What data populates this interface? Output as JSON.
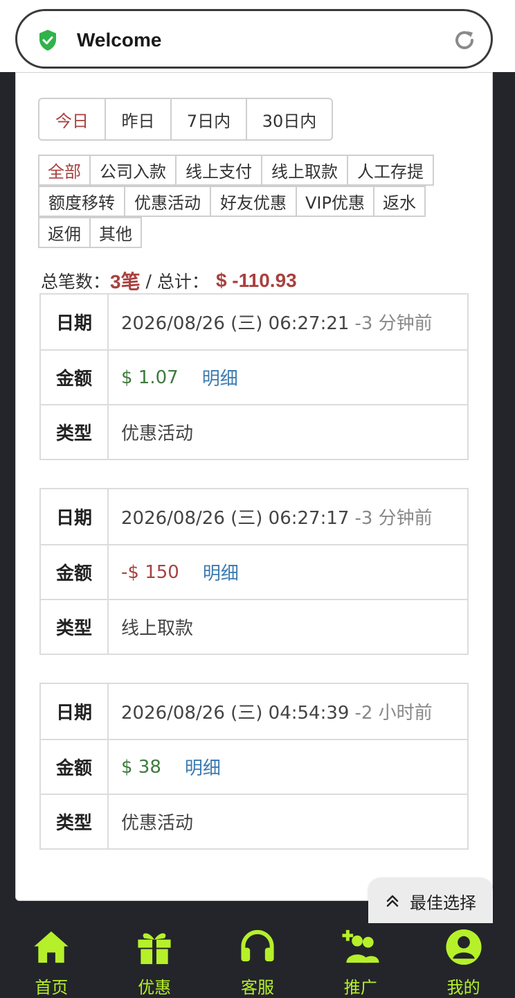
{
  "header": {
    "title": "Welcome"
  },
  "ranges": [
    {
      "label": "今日",
      "active": true
    },
    {
      "label": "昨日",
      "active": false
    },
    {
      "label": "7日内",
      "active": false
    },
    {
      "label": "30日内",
      "active": false
    }
  ],
  "filters": [
    {
      "label": "全部",
      "active": true
    },
    {
      "label": "公司入款"
    },
    {
      "label": "线上支付"
    },
    {
      "label": "线上取款"
    },
    {
      "label": "人工存提"
    },
    {
      "label": "额度移转"
    },
    {
      "label": "优惠活动"
    },
    {
      "label": "好友优惠"
    },
    {
      "label": "VIP优惠"
    },
    {
      "label": "返水"
    },
    {
      "label": "返佣"
    },
    {
      "label": "其他"
    }
  ],
  "summary": {
    "count_label": "总笔数：",
    "count": "3笔",
    "sep": " / ",
    "total_label": "总计：",
    "total": "$ -110.93"
  },
  "labels": {
    "date": "日期",
    "amount": "金额",
    "type": "类型",
    "detail": "明细"
  },
  "records": [
    {
      "date": "2026/08/26 (三) 06:27:21",
      "ago": "-3 分钟前",
      "amount": "$ 1.07",
      "sign": "pos",
      "type": "优惠活动"
    },
    {
      "date": "2026/08/26 (三) 06:27:17",
      "ago": "-3 分钟前",
      "amount": "-$ 150",
      "sign": "neg",
      "type": "线上取款"
    },
    {
      "date": "2026/08/26 (三) 04:54:39",
      "ago": "-2 小时前",
      "amount": "$ 38",
      "sign": "pos",
      "type": "优惠活动"
    }
  ],
  "best_choice": "最佳选择",
  "nav": [
    {
      "label": "首页",
      "icon": "home-icon"
    },
    {
      "label": "优惠",
      "icon": "gift-icon"
    },
    {
      "label": "客服",
      "icon": "headset-icon"
    },
    {
      "label": "推广",
      "icon": "add-users-icon"
    },
    {
      "label": "我的",
      "icon": "user-icon"
    }
  ],
  "colors": {
    "accent": "#b6f02a",
    "negative": "#a8413f",
    "positive": "#3e7a3e",
    "link": "#3b7bb0",
    "shield": "#2fb34a"
  }
}
